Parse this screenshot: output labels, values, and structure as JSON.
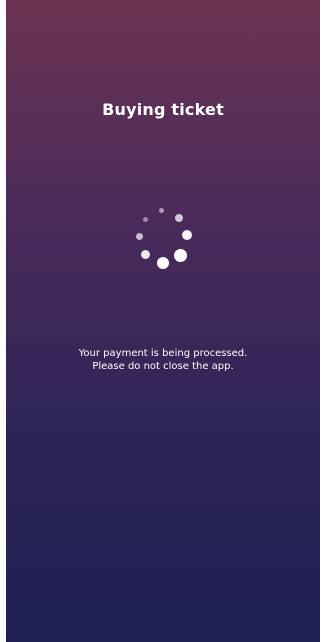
{
  "header": {
    "title": "Buying ticket"
  },
  "status": {
    "line1": "Your payment is being processed.",
    "line2": "Please do not close the app."
  },
  "spinner": {
    "icon": "loading-spinner-icon",
    "color": "#ffffff"
  },
  "colors": {
    "gradient_top": "#6b3352",
    "gradient_bottom": "#1f1f52"
  }
}
